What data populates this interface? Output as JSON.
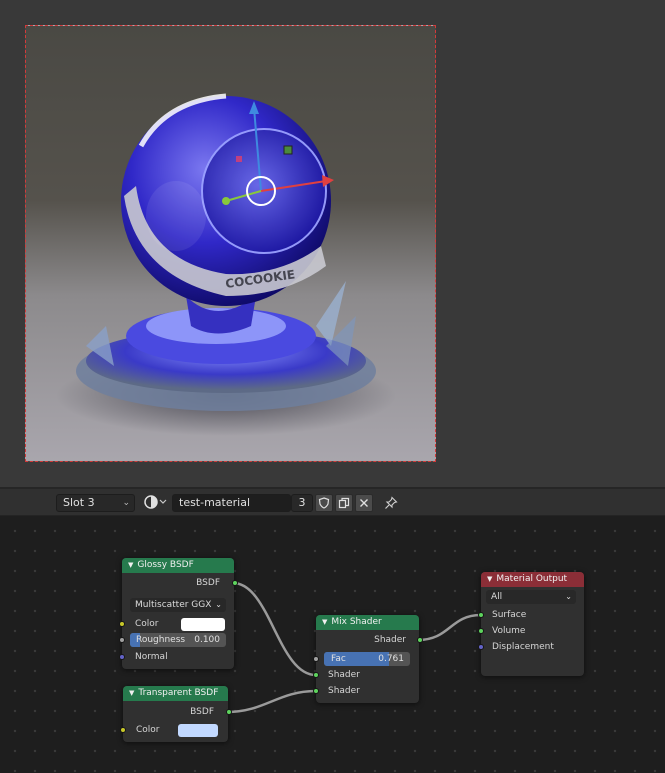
{
  "header": {
    "slot_label": "Slot 3",
    "material_name": "test-material",
    "user_count": "3"
  },
  "icons": {
    "slot_chevron": "chevron-down-icon",
    "material_browse": "material-sphere-icon",
    "fake_user": "shield-icon",
    "duplicate": "duplicate-icon",
    "unlink": "close-icon",
    "pin": "pin-icon"
  },
  "nodes": {
    "glossy": {
      "title": "Glossy BSDF",
      "output_bsdf": "BSDF",
      "distribution": "Multiscatter GGX",
      "color_label": "Color",
      "color_value": "#ffffff",
      "roughness_label": "Roughness",
      "roughness_value": "0.100",
      "roughness_fraction": 0.1,
      "normal_label": "Normal"
    },
    "transparent": {
      "title": "Transparent BSDF",
      "output_bsdf": "BSDF",
      "color_label": "Color",
      "color_value": "#c2d9ff"
    },
    "mix": {
      "title": "Mix Shader",
      "output_shader": "Shader",
      "fac_label": "Fac",
      "fac_value": "0.761",
      "fac_fraction": 0.761,
      "input1": "Shader",
      "input2": "Shader"
    },
    "output": {
      "title": "Material Output",
      "target": "All",
      "surface": "Surface",
      "volume": "Volume",
      "displacement": "Displacement"
    }
  },
  "colors": {
    "shader_node_header": "#267a4d",
    "output_node_header": "#8b2e37",
    "shader_socket": "#5ed45e",
    "color_socket": "#c7c729",
    "float_socket": "#a1a1a1",
    "vector_socket": "#6363c7",
    "slider_fill": "#4772b3",
    "render_border": "#d23a3a"
  },
  "render": {
    "label_text": "COCOOKIE"
  }
}
